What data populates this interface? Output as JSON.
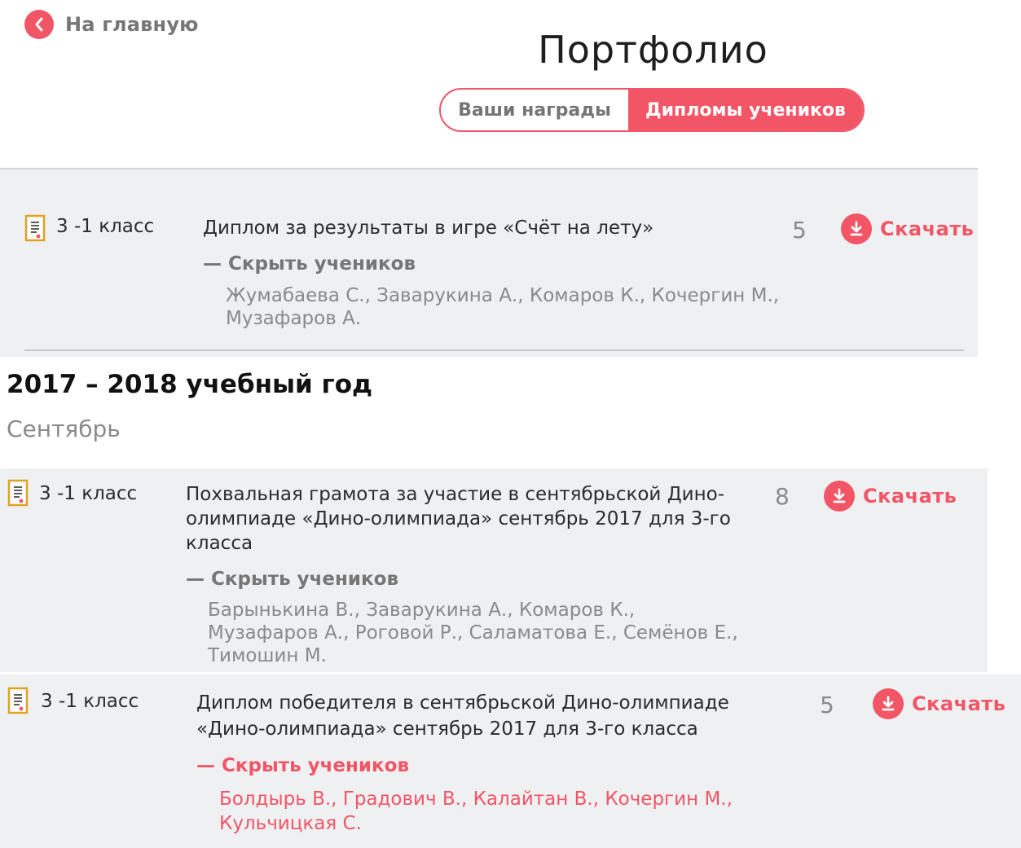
{
  "nav": {
    "back_label": "На главную"
  },
  "page": {
    "title": "Портфолио"
  },
  "tabs": {
    "awards": "Ваши награды",
    "diplomas": "Дипломы учеников"
  },
  "hide_students_label": "— Скрыть учеников",
  "download_label": "Скачать",
  "top_item": {
    "class": "3 -1 класс",
    "description": "Диплом за результаты в игре «Счёт на лету»",
    "count": "5",
    "students": [
      "Жумабаева С., Заварукина А., Комаров К., Кочергин М.,",
      "Музафаров А."
    ]
  },
  "year_section": {
    "title": "2017 – 2018 учебный год",
    "month": "Сентябрь"
  },
  "items": [
    {
      "class": "3 -1 класс",
      "description": [
        "Похвальная грамота за участие в сентябрьской Дино-",
        "олимпиаде «Дино-олимпиада» сентябрь 2017 для 3-го",
        "класса"
      ],
      "count": "8",
      "students": [
        "Барынькина В., Заварукина А., Комаров К.,",
        "Музафаров А., Роговой Р., Саламатова Е., Семёнов Е.,",
        "Тимошин М."
      ]
    },
    {
      "class": "3 -1 класс",
      "description": [
        "Диплом победителя в сентябрьской Дино-олимпиаде",
        "«Дино-олимпиада» сентябрь 2017 для 3-го класса"
      ],
      "count": "5",
      "students": [
        "Болдырь В., Градович В., Калайтан В., Кочергин М.,",
        "Кульчицкая С."
      ]
    }
  ],
  "colors": {
    "accent": "#f25566",
    "panel_bg": "#eef0f2",
    "muted_text": "#8a8a8a",
    "icon_gold": "#e0a320"
  }
}
